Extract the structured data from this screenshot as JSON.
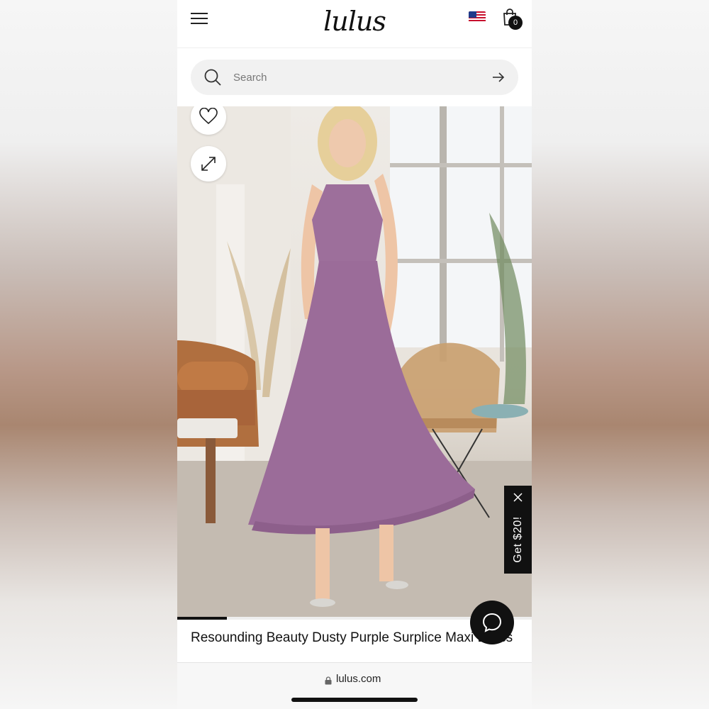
{
  "header": {
    "logo": "lulus",
    "cart_count": "0",
    "icons": [
      "menu-icon",
      "us-flag-icon",
      "shopping-bag-icon"
    ]
  },
  "search": {
    "placeholder": "Search",
    "icons": [
      "search-icon",
      "arrow-right-icon"
    ]
  },
  "product": {
    "title": "Resounding Beauty Dusty Purple Surplice Maxi Dress",
    "image_subject": "model in dusty purple maxi dress",
    "image_progress": 0.14,
    "dress_color": "#9d6f9b"
  },
  "promo": {
    "label": "Get $20!"
  },
  "browser": {
    "url": "lulus.com"
  },
  "colors": {
    "accent": "#111111",
    "search_bg": "#f1f1f1"
  }
}
